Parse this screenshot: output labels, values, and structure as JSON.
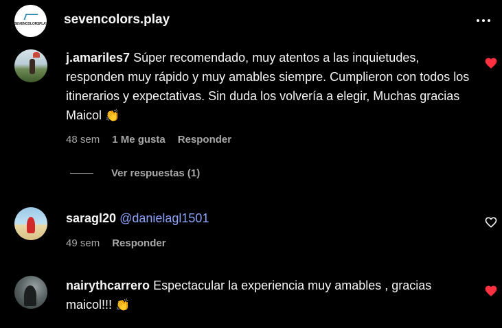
{
  "header": {
    "account_name": "sevencolors.play",
    "avatar_text": "SEVENCOLORSPLAY"
  },
  "colors": {
    "background": "#000000",
    "text": "#f5f5f5",
    "muted": "#a8a8a8",
    "mention": "#8ba4f9",
    "heart_liked": "#ff3040"
  },
  "comments": [
    {
      "username": "j.amariles7",
      "text": " Súper recomendado, muy atentos a las inquietudes, responden muy rápido y muy amables siempre. Cumplieron con todos los itinerarios y expectativas. Sin duda los volvería a elegir, Muchas gracias Maicol",
      "emoji": "👏",
      "time": "48 sem",
      "likes": "1 Me gusta",
      "reply": "Responder",
      "liked": true
    },
    {
      "username": "saragl20",
      "mention": "@danielagl1501",
      "time": "49 sem",
      "reply": "Responder",
      "liked": false
    },
    {
      "username": "nairythcarrero",
      "text": " Espectacular la experiencia muy amables , gracias maicol!!!",
      "emoji": "👏",
      "liked": true
    }
  ],
  "view_replies": {
    "label": "Ver respuestas (1)"
  }
}
